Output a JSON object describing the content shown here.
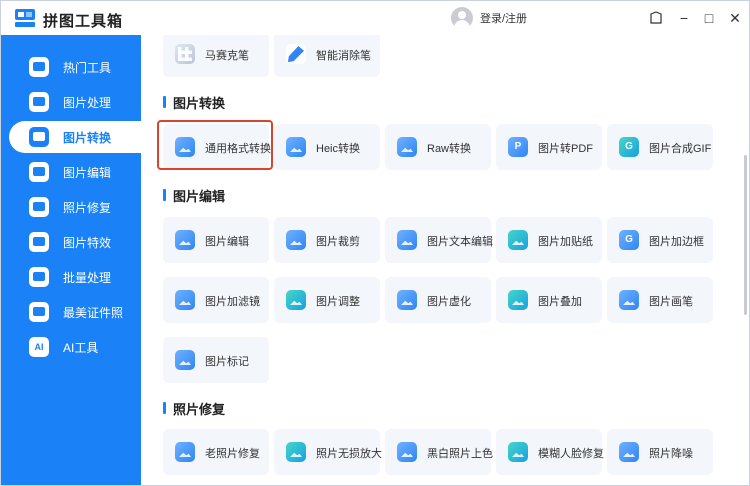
{
  "app": {
    "title": "拼图工具箱"
  },
  "header": {
    "login_label": "登录/注册",
    "minimize": "−",
    "maximize": "□",
    "close": "✕",
    "skin": "⌂"
  },
  "sidebar": {
    "items": [
      {
        "label": "热门工具",
        "icon": "tools-icon"
      },
      {
        "label": "图片处理",
        "icon": "image-process-icon"
      },
      {
        "label": "图片转换",
        "icon": "image-convert-icon",
        "active": true
      },
      {
        "label": "图片编辑",
        "icon": "image-edit-icon"
      },
      {
        "label": "照片修复",
        "icon": "photo-repair-icon"
      },
      {
        "label": "图片特效",
        "icon": "image-effect-icon"
      },
      {
        "label": "批量处理",
        "icon": "batch-icon"
      },
      {
        "label": "最美证件照",
        "icon": "id-photo-icon"
      },
      {
        "label": "AI工具",
        "icon": "ai-icon",
        "badge": "AI"
      }
    ]
  },
  "top_cards": [
    {
      "label": "马赛克笔",
      "icon": "mosaic-icon"
    },
    {
      "label": "智能消除笔",
      "icon": "eraser-pen-icon"
    }
  ],
  "sections": {
    "convert": {
      "title": "图片转换",
      "cards": [
        {
          "label": "通用格式转换",
          "icon": "format-convert-icon",
          "highlighted": true
        },
        {
          "label": "Heic转换",
          "icon": "heic-icon"
        },
        {
          "label": "Raw转换",
          "icon": "raw-icon"
        },
        {
          "label": "图片转PDF",
          "icon": "pdf-icon",
          "letter": "P"
        },
        {
          "label": "图片合成GIF",
          "icon": "gif-icon",
          "letter": "G"
        }
      ]
    },
    "edit": {
      "title": "图片编辑",
      "cards": [
        {
          "label": "图片编辑",
          "icon": "edit-icon"
        },
        {
          "label": "图片裁剪",
          "icon": "crop-icon"
        },
        {
          "label": "图片文本编辑",
          "icon": "text-edit-icon"
        },
        {
          "label": "图片加贴纸",
          "icon": "sticker-icon"
        },
        {
          "label": "图片加边框",
          "icon": "frame-icon",
          "letter": "G"
        },
        {
          "label": "图片加滤镜",
          "icon": "filter-icon"
        },
        {
          "label": "图片调整",
          "icon": "adjust-icon"
        },
        {
          "label": "图片虚化",
          "icon": "blur-icon"
        },
        {
          "label": "图片叠加",
          "icon": "overlay-icon"
        },
        {
          "label": "图片画笔",
          "icon": "brush-icon"
        },
        {
          "label": "图片标记",
          "icon": "mark-icon"
        }
      ]
    },
    "repair": {
      "title": "照片修复",
      "cards": [
        {
          "label": "老照片修复",
          "icon": "old-photo-icon"
        },
        {
          "label": "照片无损放大",
          "icon": "upscale-icon"
        },
        {
          "label": "黑白照片上色",
          "icon": "colorize-icon"
        },
        {
          "label": "模糊人脸修复",
          "icon": "face-repair-icon"
        },
        {
          "label": "照片降噪",
          "icon": "denoise-icon"
        }
      ]
    }
  },
  "colors": {
    "accent": "#1a82f6",
    "card_bg": "#f3f6fb",
    "highlight": "#d9442e"
  }
}
